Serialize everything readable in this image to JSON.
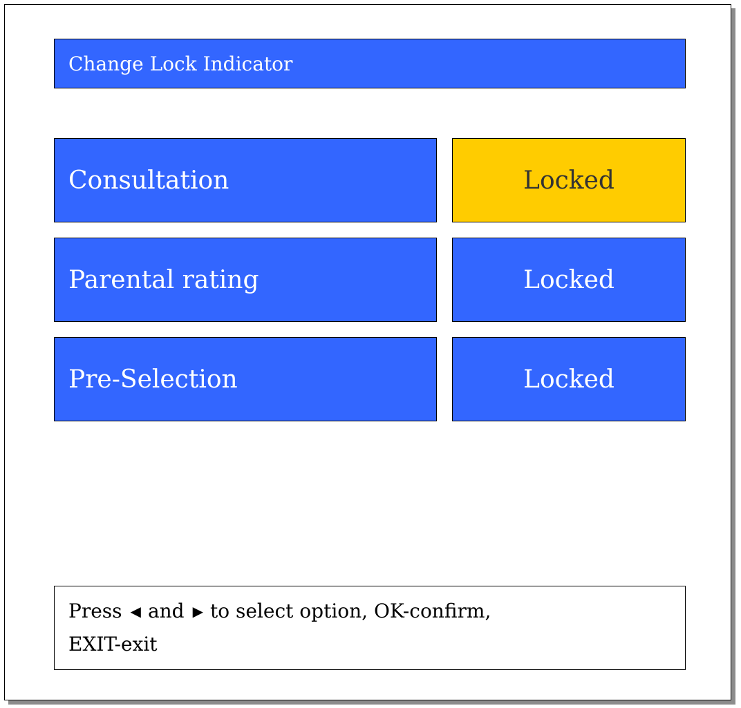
{
  "window": {
    "title": "Change Lock Indicator"
  },
  "rows": [
    {
      "label": "Consultation",
      "value": "Locked",
      "selected": true
    },
    {
      "label": "Parental rating",
      "value": "Locked",
      "selected": false
    },
    {
      "label": "Pre-Selection",
      "value": "Locked",
      "selected": false
    }
  ],
  "colors": {
    "panel_blue": "#3366ff",
    "selected_yellow": "#ffcc00",
    "shadow_gray": "#8c8c8c"
  },
  "help": {
    "press": "Press",
    "left_arrow": "◀",
    "and": "and",
    "right_arrow": "▶",
    "rest_line1": "to select option, OK-confirm,",
    "line2": "EXIT-exit",
    "left_arrow_icon": "left-arrow-icon",
    "right_arrow_icon": "right-arrow-icon"
  }
}
